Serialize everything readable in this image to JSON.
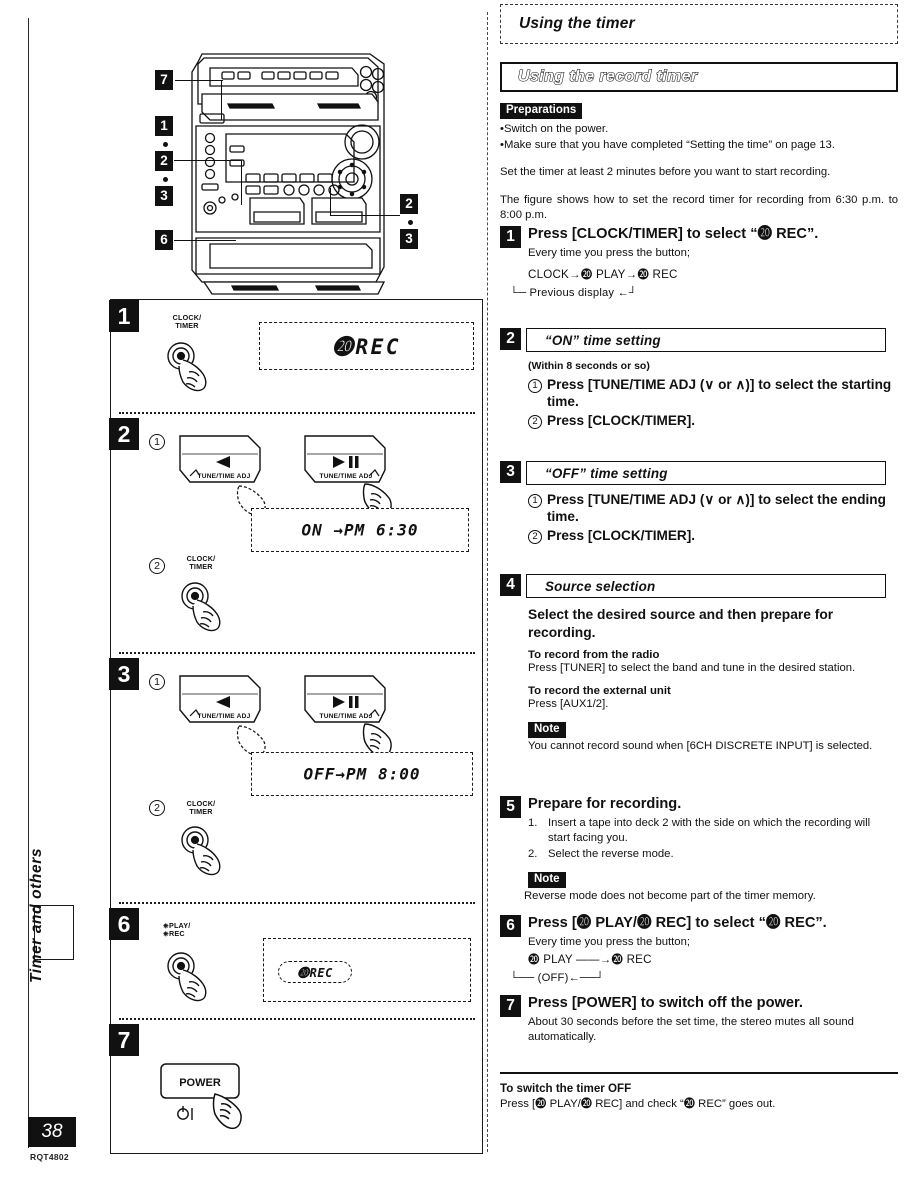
{
  "page": {
    "number": "38",
    "doc_code": "RQT4802",
    "side_tab_label": "Timer and others"
  },
  "header": {
    "title": "Using the timer",
    "section": "Using the record timer"
  },
  "preparations": {
    "tag": "Preparations",
    "bullets": [
      "Switch on the power.",
      "Make sure that you have completed “Setting the time” on page 13."
    ]
  },
  "intro": {
    "line1": "Set the timer at least 2 minutes before you want to start recording.",
    "line2": "The figure shows how to set the record timer for recording from 6:30 p.m. to 8:00 p.m."
  },
  "steps": [
    {
      "num": "1",
      "heading": "Press [CLOCK/TIMER] to select “⓴ REC”.",
      "sub": "Every time you press the button;",
      "flow_line1": "CLOCK→⓴ PLAY→⓴ REC",
      "flow_line2": "└─ Previous display ←┘"
    },
    {
      "num": "2",
      "box_title": "“ON” time setting",
      "note": "(Within 8 seconds or so)",
      "items": [
        "Press [TUNE/TIME ADJ (∨ or ∧)] to select the starting time.",
        "Press [CLOCK/TIMER]."
      ]
    },
    {
      "num": "3",
      "box_title": "“OFF” time setting",
      "items": [
        "Press [TUNE/TIME ADJ (∨ or ∧)] to select the ending time.",
        "Press [CLOCK/TIMER]."
      ]
    },
    {
      "num": "4",
      "box_title": "Source selection",
      "heading": "Select the desired source and then prepare for recording.",
      "radio_head": "To record from the radio",
      "radio_body": "Press [TUNER] to select the band and tune in the desired station.",
      "ext_head": "To record the external unit",
      "ext_body": "Press [AUX1/2].",
      "note_tag": "Note",
      "note_body": "You cannot record sound when [6CH DISCRETE INPUT] is selected."
    },
    {
      "num": "5",
      "heading": "Prepare for recording.",
      "items": [
        {
          "n": "1.",
          "t": "Insert a tape into deck 2 with the side on which the recording will start facing you."
        },
        {
          "n": "2.",
          "t": "Select the reverse mode."
        }
      ],
      "note_tag": "Note",
      "note_body": "Reverse mode does not become part of the timer memory."
    },
    {
      "num": "6",
      "heading": "Press [⓴ PLAY/⓴ REC] to select “⓴ REC”.",
      "sub": "Every time you press the button;",
      "flow_line1": "⓴ PLAY ——→⓴ REC",
      "flow_line2": "└── (OFF)←──┘"
    },
    {
      "num": "7",
      "heading": "Press [POWER] to switch off the power.",
      "sub": "About 30 seconds before the set time, the stereo mutes all sound automatically."
    }
  ],
  "footer": {
    "head": "To switch the timer OFF",
    "body": "Press [⓴ PLAY/⓴ REC] and check “⓴ REC” goes out."
  },
  "illustration": {
    "markers": [
      "7",
      "1",
      "2",
      "3",
      "2",
      "3",
      "6"
    ]
  },
  "diagram": {
    "steps": [
      {
        "num": "1",
        "button_caption": "CLOCK/\nTIMER",
        "lcd": "⓴REC"
      },
      {
        "num": "2",
        "circle1": "1",
        "circle2": "2",
        "btn_left_caption": "TUNE/TIME ADJ",
        "btn_right_caption": "TUNE/TIME ADJ",
        "button_caption": "CLOCK/\nTIMER",
        "lcd": "ON →PM 6:30"
      },
      {
        "num": "3",
        "circle1": "1",
        "circle2": "2",
        "btn_left_caption": "TUNE/TIME ADJ",
        "btn_right_caption": "TUNE/TIME ADJ",
        "button_caption": "CLOCK/\nTIMER",
        "lcd": "OFF→PM 8:00"
      },
      {
        "num": "6",
        "button_caption": "⓴ PLAY/\n⓴ REC",
        "lcd": "⓴REC"
      },
      {
        "num": "7",
        "power_label": "POWER",
        "power_symbol": "⏻/I"
      }
    ]
  }
}
